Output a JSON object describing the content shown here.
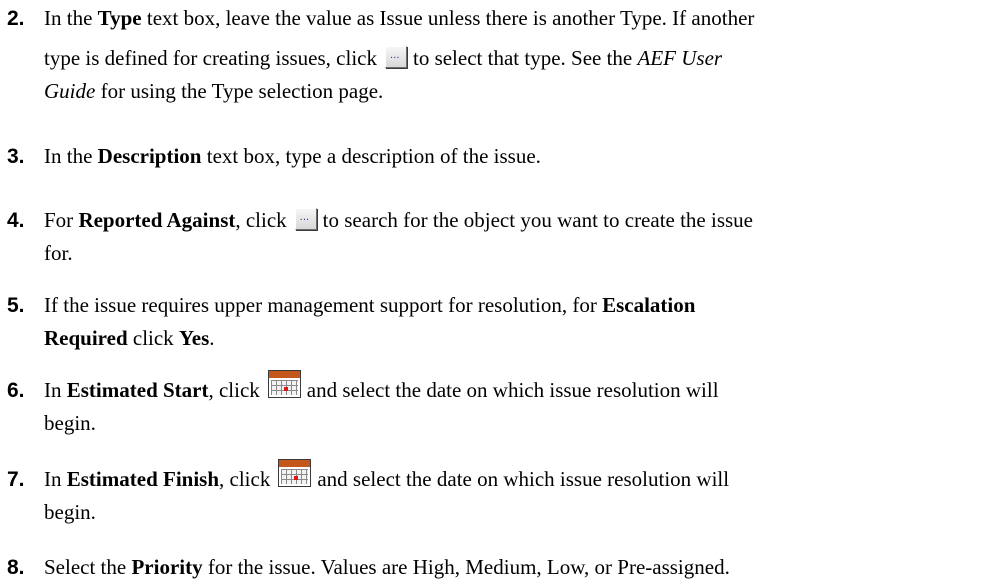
{
  "steps": [
    {
      "number": "2.",
      "lines": [
        {
          "t1": "In the ",
          "b1": "Type",
          "t2": " text box, leave the value as Issue unless there is another Type. If another"
        },
        {
          "t1": "type is defined for creating issues, click",
          "icon": "browse-icon",
          "t2": "to select that type. See the ",
          "i1": "AEF User"
        },
        {
          "i1": "Guide",
          "t1": " for using the Type selection page."
        }
      ]
    },
    {
      "number": "3.",
      "lines": [
        {
          "t1": "In the ",
          "b1": "Description",
          "t2": " text box, type a description of the issue."
        }
      ]
    },
    {
      "number": "4.",
      "lines": [
        {
          "t1": "For ",
          "b1": "Reported Against",
          "t2": ", click",
          "icon": "browse-icon",
          "t3": "to search for the object you want to create the issue"
        },
        {
          "t1": "for."
        }
      ]
    },
    {
      "number": "5.",
      "lines": [
        {
          "t1": "If the issue requires upper management support for resolution, for ",
          "b1": "Escalation"
        },
        {
          "b1": "Required",
          "t1": " click ",
          "b2": "Yes",
          "t2": "."
        }
      ]
    },
    {
      "number": "6.",
      "lines": [
        {
          "t1": "In ",
          "b1": "Estimated Start",
          "t2": ", click",
          "icon": "calendar-icon",
          "t3": "and select the date on which issue resolution will"
        },
        {
          "t1": "begin."
        }
      ]
    },
    {
      "number": "7.",
      "lines": [
        {
          "t1": "In ",
          "b1": "Estimated Finish",
          "t2": ", click",
          "icon": "calendar-icon",
          "t3": "and select the date on which issue resolution will"
        },
        {
          "t1": "begin."
        }
      ]
    },
    {
      "number": "8.",
      "lines": [
        {
          "t1": "Select the ",
          "b1": "Priority",
          "t2": " for the issue. Values are High, Medium, Low, or Pre-assigned."
        }
      ]
    }
  ],
  "icons": {
    "browse_glyph": "..."
  }
}
